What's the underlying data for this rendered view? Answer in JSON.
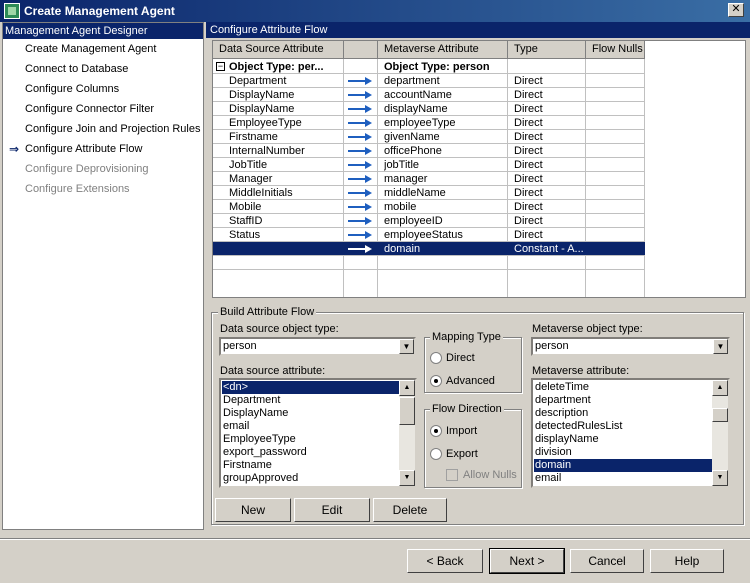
{
  "window": {
    "title": "Create Management Agent",
    "close_glyph": "✕"
  },
  "left": {
    "header": "Management Agent Designer",
    "items": [
      {
        "label": "Create Management Agent",
        "state": "normal"
      },
      {
        "label": "Connect to Database",
        "state": "normal"
      },
      {
        "label": "Configure Columns",
        "state": "normal"
      },
      {
        "label": "Configure Connector Filter",
        "state": "normal"
      },
      {
        "label": "Configure Join and Projection Rules",
        "state": "normal"
      },
      {
        "label": "Configure Attribute Flow",
        "state": "current"
      },
      {
        "label": "Configure Deprovisioning",
        "state": "disabled"
      },
      {
        "label": "Configure Extensions",
        "state": "disabled"
      }
    ]
  },
  "right": {
    "header": "Configure Attribute Flow"
  },
  "grid": {
    "columns": [
      "Data Source Attribute",
      "",
      "Metaverse Attribute",
      "Type",
      "Flow Nulls"
    ],
    "object_type_label": "Object Type: per...",
    "object_type_mv": "Object Type: person",
    "expander": "−",
    "rows": [
      {
        "ds": "Department",
        "mv": "department",
        "type": "Direct"
      },
      {
        "ds": "DisplayName",
        "mv": "accountName",
        "type": "Direct"
      },
      {
        "ds": "DisplayName",
        "mv": "displayName",
        "type": "Direct"
      },
      {
        "ds": "EmployeeType",
        "mv": "employeeType",
        "type": "Direct"
      },
      {
        "ds": "Firstname",
        "mv": "givenName",
        "type": "Direct"
      },
      {
        "ds": "InternalNumber",
        "mv": "officePhone",
        "type": "Direct"
      },
      {
        "ds": "JobTitle",
        "mv": "jobTitle",
        "type": "Direct"
      },
      {
        "ds": "Manager",
        "mv": "manager",
        "type": "Direct"
      },
      {
        "ds": "MiddleInitials",
        "mv": "middleName",
        "type": "Direct"
      },
      {
        "ds": "Mobile",
        "mv": "mobile",
        "type": "Direct"
      },
      {
        "ds": "StaffID",
        "mv": "employeeID",
        "type": "Direct"
      },
      {
        "ds": "Status",
        "mv": "employeeStatus",
        "type": "Direct"
      },
      {
        "ds": "",
        "mv": "domain",
        "type": "Constant - A...",
        "selected": true
      }
    ]
  },
  "build": {
    "legend": "Build Attribute Flow",
    "ds_object_type_label": "Data source object type:",
    "ds_object_type_value": "person",
    "ds_attribute_label": "Data source attribute:",
    "ds_attributes": [
      "<dn>",
      "Department",
      "DisplayName",
      "email",
      "EmployeeType",
      "export_password",
      "Firstname",
      "groupApproved"
    ],
    "ds_selected_index": 0,
    "mapping_legend": "Mapping Type",
    "mapping_direct": "Direct",
    "mapping_advanced": "Advanced",
    "mapping_selected": "advanced",
    "flow_legend": "Flow Direction",
    "flow_import": "Import",
    "flow_export": "Export",
    "flow_selected": "import",
    "allow_nulls": "Allow Nulls",
    "mv_object_type_label": "Metaverse object type:",
    "mv_object_type_value": "person",
    "mv_attribute_label": "Metaverse attribute:",
    "mv_attributes": [
      "deleteTime",
      "department",
      "description",
      "detectedRulesList",
      "displayName",
      "division",
      "domain",
      "email"
    ],
    "mv_selected_index": 6,
    "new_label": "New",
    "edit_label": "Edit",
    "delete_label": "Delete"
  },
  "footer": {
    "back_label": "< Back",
    "next_label": "Next >",
    "cancel_label": "Cancel",
    "help_label": "Help"
  }
}
